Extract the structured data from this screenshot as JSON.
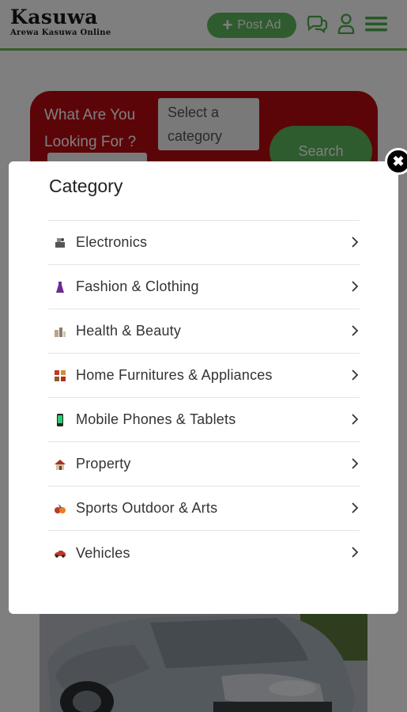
{
  "header": {
    "logo_title": "Kasuwa",
    "logo_subtitle": "Arewa Kasuwa Online",
    "post_ad_label": "Post Ad",
    "icons": [
      "chat-icon",
      "user-icon",
      "menu-icon"
    ]
  },
  "search": {
    "question": "What Are You Looking For ?",
    "select_placeholder": "Select a category",
    "button_label": "Search"
  },
  "modal": {
    "title": "Category",
    "close_symbol": "✖",
    "items": [
      {
        "label": "Electronics",
        "icon": "electronics-icon"
      },
      {
        "label": "Fashion & Clothing",
        "icon": "dress-icon"
      },
      {
        "label": "Health & Beauty",
        "icon": "beauty-products-icon"
      },
      {
        "label": "Home Furnitures & Appliances",
        "icon": "furniture-icon"
      },
      {
        "label": "Mobile Phones & Tablets",
        "icon": "phone-icon"
      },
      {
        "label": "Property",
        "icon": "house-icon"
      },
      {
        "label": "Sports Outdoor & Arts",
        "icon": "sports-icon"
      },
      {
        "label": "Vehicles",
        "icon": "car-icon"
      }
    ]
  },
  "colors": {
    "brand_green": "#5cb85c",
    "search_red": "#b80b10",
    "overlay": "rgba(0,0,0,0.5)"
  }
}
